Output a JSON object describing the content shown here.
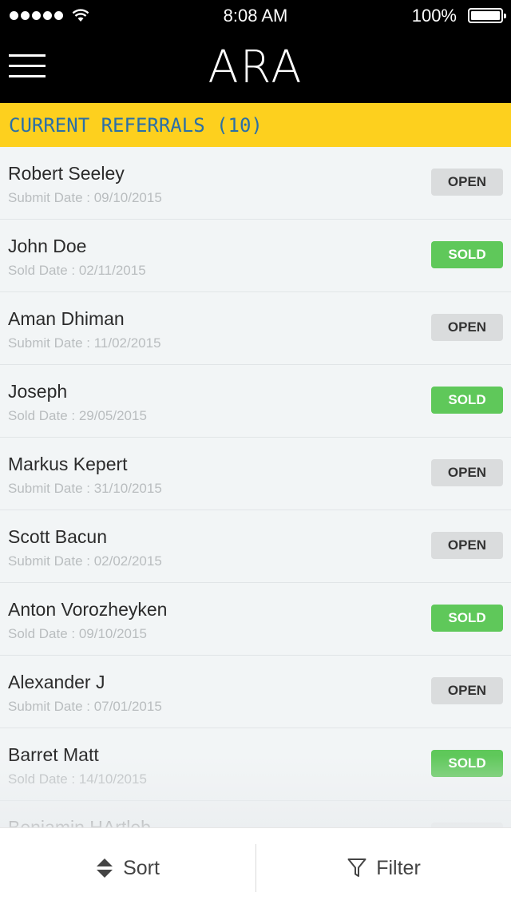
{
  "status_bar": {
    "time": "8:08 AM",
    "battery": "100%"
  },
  "nav": {
    "title": "ARA"
  },
  "section": {
    "title": "CURRENT REFERRALS (10)"
  },
  "referrals": [
    {
      "name": "Robert Seeley",
      "date": "Submit Date : 09/10/2015",
      "status": "OPEN"
    },
    {
      "name": "John Doe",
      "date": "Sold Date : 02/11/2015",
      "status": "SOLD"
    },
    {
      "name": "Aman Dhiman",
      "date": "Submit Date : 11/02/2015",
      "status": "OPEN"
    },
    {
      "name": "Joseph",
      "date": "Sold Date : 29/05/2015",
      "status": "SOLD"
    },
    {
      "name": "Markus Kepert",
      "date": "Submit Date : 31/10/2015",
      "status": "OPEN"
    },
    {
      "name": "Scott Bacun",
      "date": "Submit Date : 02/02/2015",
      "status": "OPEN"
    },
    {
      "name": "Anton Vorozheyken",
      "date": "Sold Date : 09/10/2015",
      "status": "SOLD"
    },
    {
      "name": "Alexander J",
      "date": "Submit Date : 07/01/2015",
      "status": "OPEN"
    },
    {
      "name": "Barret Matt",
      "date": "Sold Date : 14/10/2015",
      "status": "SOLD"
    },
    {
      "name": "Benjamin HArtleb",
      "date": "",
      "status": ""
    }
  ],
  "toolbar": {
    "sort_label": "Sort",
    "filter_label": "Filter"
  },
  "colors": {
    "header_yellow": "#fdd01e",
    "header_text": "#2a6fa8",
    "sold_green": "#5fc85a",
    "open_gray": "#dadcdd"
  },
  "icons": {
    "sort": "sort-updown-icon",
    "filter": "funnel-icon",
    "menu": "hamburger-icon"
  }
}
